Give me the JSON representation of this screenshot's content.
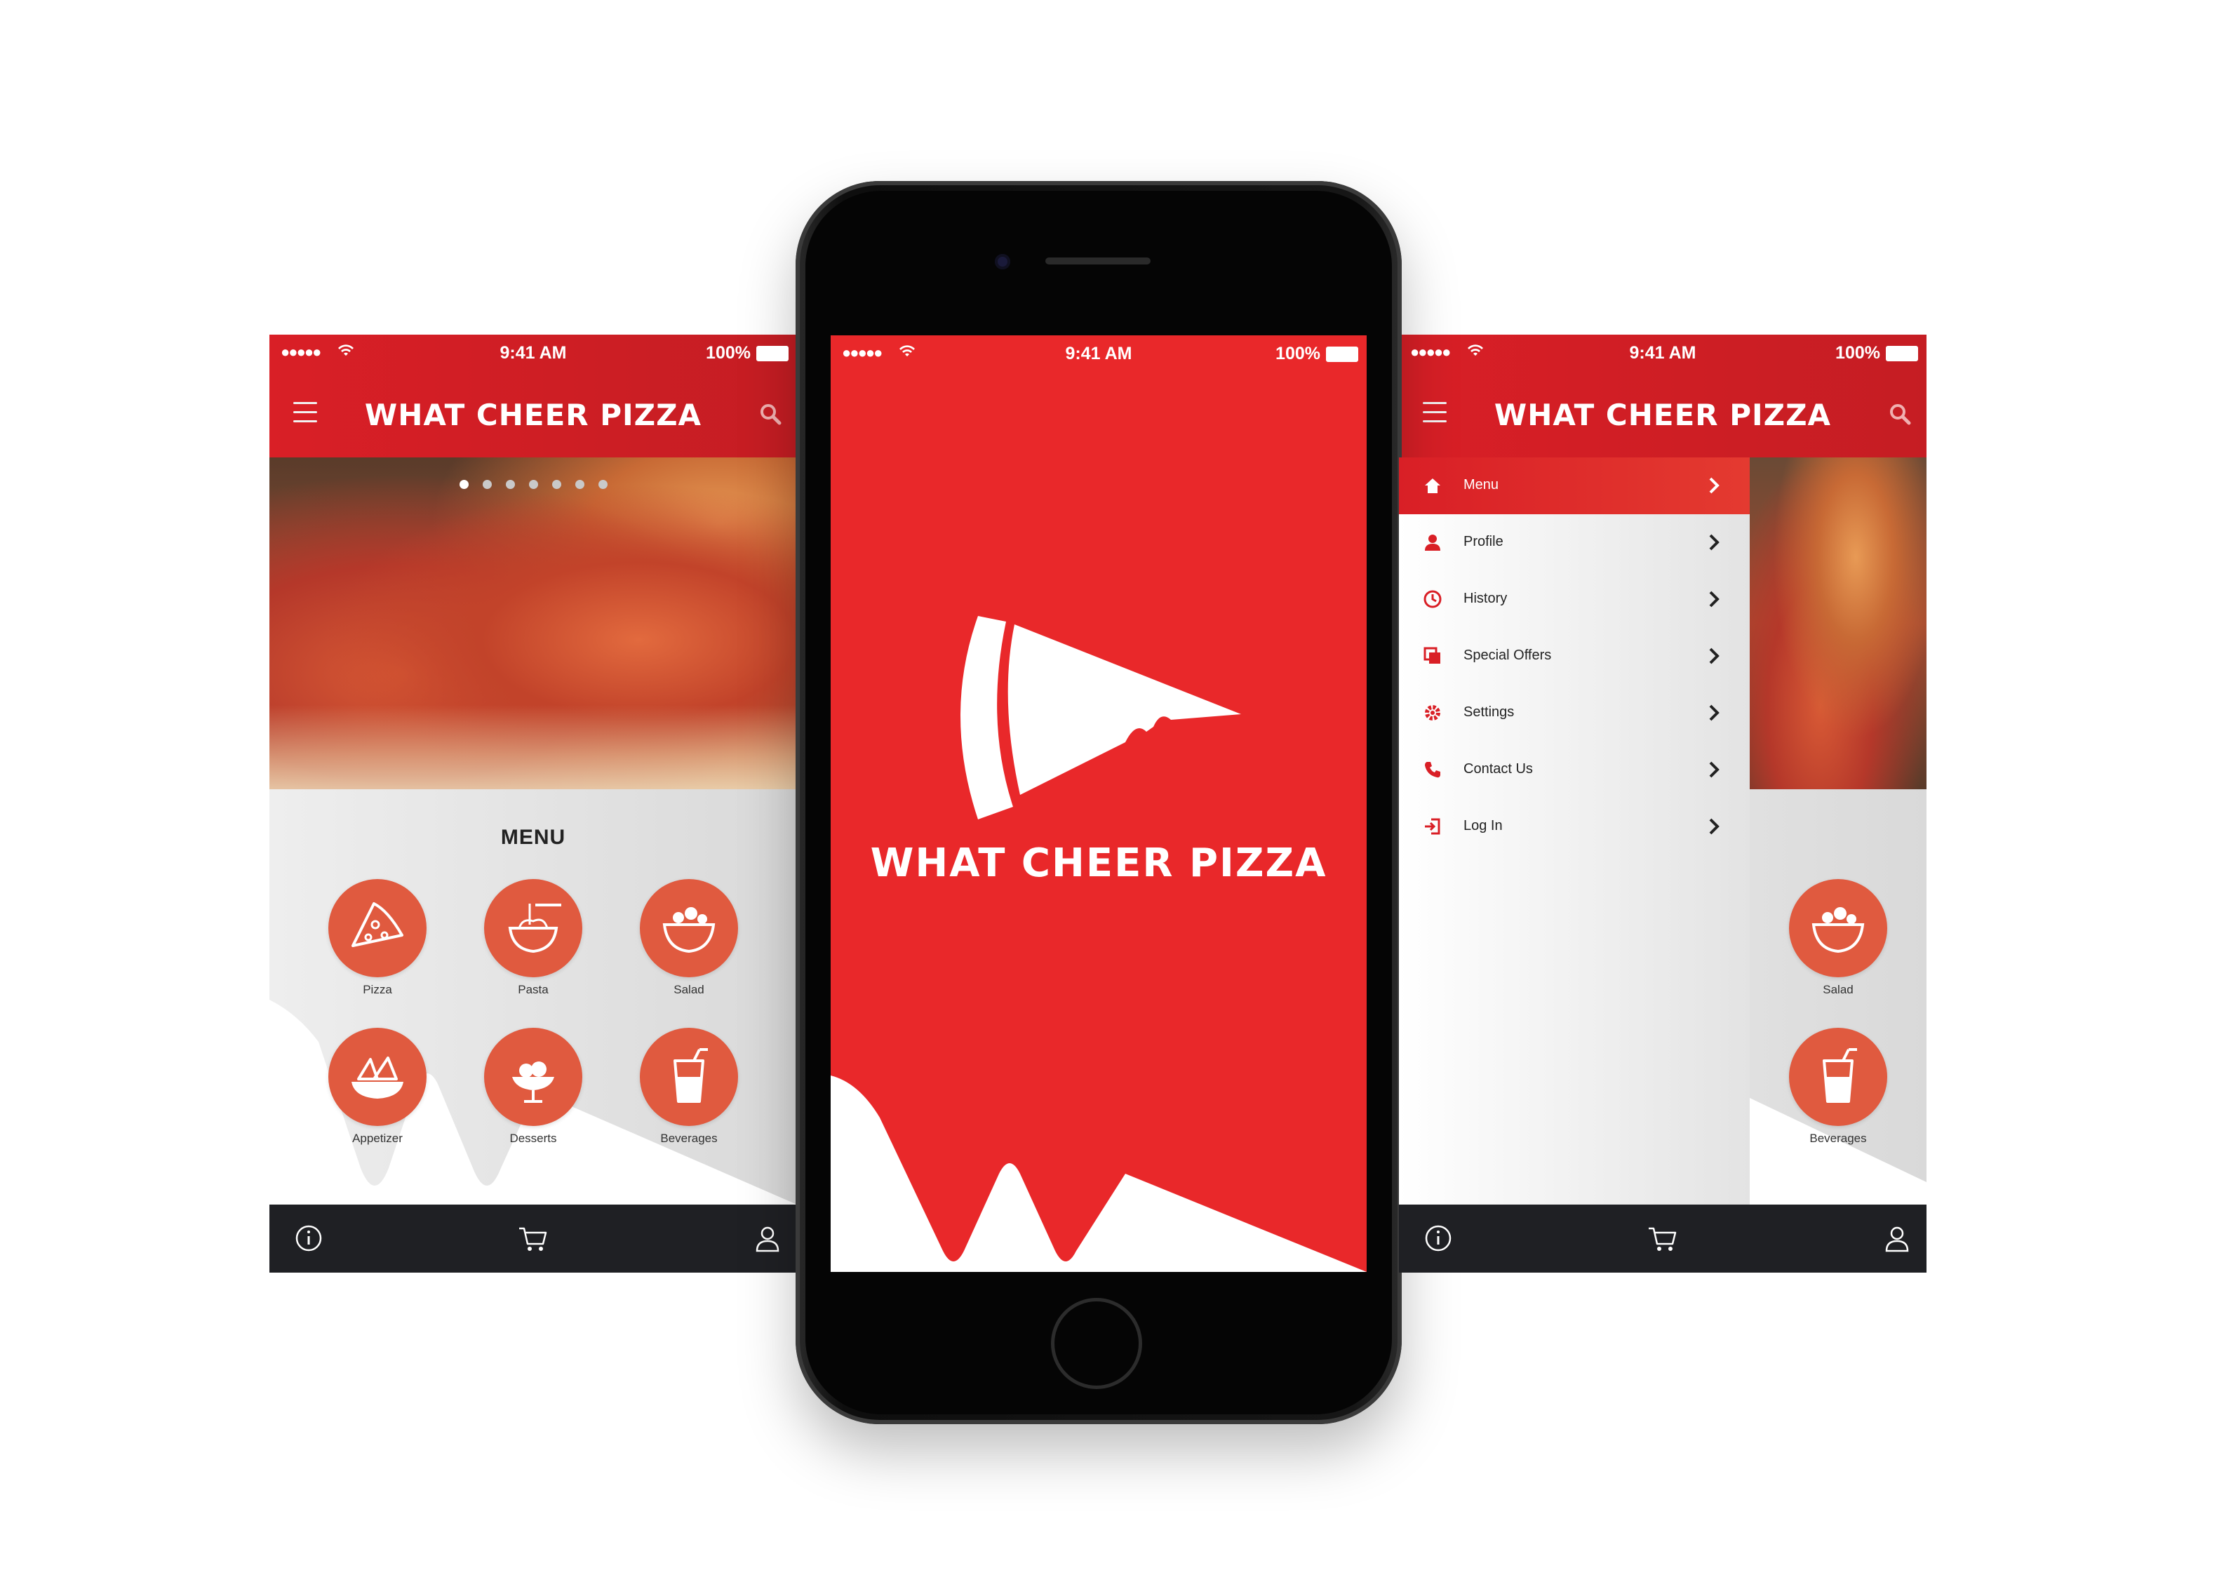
{
  "brand": {
    "name": "WHAT CHEER PIZZA",
    "accent": "#e9282a",
    "circle": "#e05a3f",
    "tabbar": "#1f2024"
  },
  "status_bar": {
    "signal": "●●●●●",
    "time": "9:41 AM",
    "battery": "100%"
  },
  "home_screen": {
    "carousel_dots": 7,
    "menu_heading": "MENU",
    "categories": [
      {
        "label": "Pizza",
        "icon": "pizza-slice-icon"
      },
      {
        "label": "Pasta",
        "icon": "pasta-bowl-icon"
      },
      {
        "label": "Salad",
        "icon": "salad-bowl-icon"
      },
      {
        "label": "Appetizer",
        "icon": "nachos-icon"
      },
      {
        "label": "Desserts",
        "icon": "sundae-icon"
      },
      {
        "label": "Beverages",
        "icon": "drink-cup-icon"
      }
    ],
    "tab_bar": [
      "info-icon",
      "cart-icon",
      "user-icon"
    ]
  },
  "splash_screen": {
    "title": "WHAT CHEER PIZZA",
    "logo": "pizza-slice-logo"
  },
  "drawer": {
    "items": [
      {
        "label": "Menu",
        "icon": "home-icon",
        "active": true
      },
      {
        "label": "Profile",
        "icon": "user-icon",
        "active": false
      },
      {
        "label": "History",
        "icon": "clock-icon",
        "active": false
      },
      {
        "label": "Special Offers",
        "icon": "offers-icon",
        "active": false
      },
      {
        "label": "Settings",
        "icon": "gear-icon",
        "active": false
      },
      {
        "label": "Contact Us",
        "icon": "phone-icon",
        "active": false
      },
      {
        "label": "Log In",
        "icon": "login-icon",
        "active": false
      }
    ],
    "visible_categories": [
      {
        "label": "Salad",
        "icon": "salad-bowl-icon"
      },
      {
        "label": "Beverages",
        "icon": "drink-cup-icon"
      }
    ]
  }
}
